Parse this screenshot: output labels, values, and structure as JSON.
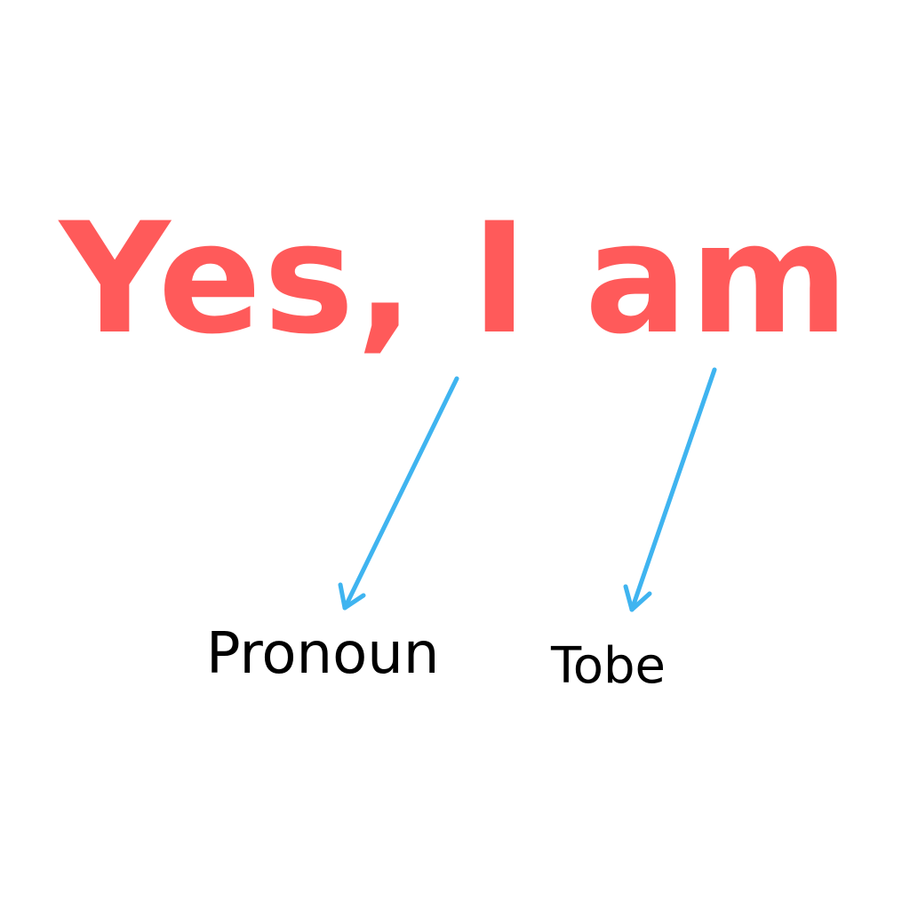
{
  "headline": {
    "text": "Yes, I am",
    "color": "#ff5a5a"
  },
  "labels": {
    "pronoun": "Pronoun",
    "tobe": "Tobe"
  },
  "arrow_color": "#3fb4f0"
}
